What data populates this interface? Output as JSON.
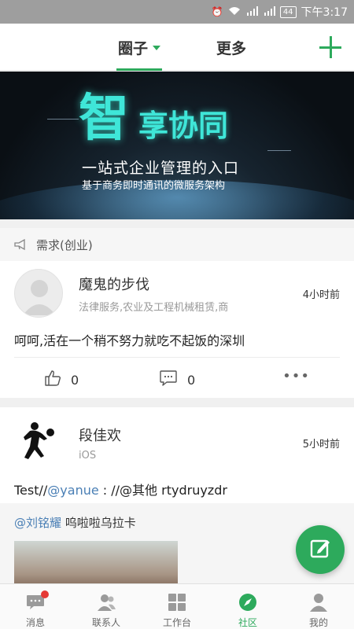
{
  "status_bar": {
    "time": "下午3:17",
    "battery": "44",
    "icons": [
      "alarm-icon",
      "wifi-icon",
      "signal-2g-icon",
      "signal-4g-icon",
      "battery-icon"
    ]
  },
  "top_nav": {
    "tabs": [
      {
        "label": "圈子",
        "active": true
      },
      {
        "label": "更多",
        "active": false
      }
    ],
    "add_icon": "plus-icon"
  },
  "banner": {
    "title_big": "智",
    "title_rest": "享协同",
    "subtitle": "一站式企业管理的入口",
    "tagline": "基于商务即时通讯的微服务架构"
  },
  "category": {
    "label": "需求(创业)",
    "icon": "megaphone-icon"
  },
  "posts": [
    {
      "author": "魔鬼的步伐",
      "meta": "法律服务,农业及工程机械租赁,商",
      "time": "4小时前",
      "content": "呵呵,活在一个稍不努力就吃不起饭的深圳",
      "likes": "0",
      "comments": "0"
    },
    {
      "author": "段佳欢",
      "meta": "iOS",
      "time": "5小时前",
      "content_prefix": "Test//",
      "content_mention": "@yanue",
      "content_suffix": " : //@其他 rtydruyzdr",
      "quote_mention": "@刘铭耀",
      "quote_text": " 呜啦啦乌拉卡"
    }
  ],
  "bottom_tabs": [
    {
      "label": "消息",
      "icon": "chat-icon",
      "active": false,
      "badge": true
    },
    {
      "label": "联系人",
      "icon": "contacts-icon",
      "active": false,
      "badge": false
    },
    {
      "label": "工作台",
      "icon": "grid-icon",
      "active": false,
      "badge": false
    },
    {
      "label": "社区",
      "icon": "compass-icon",
      "active": true,
      "badge": false
    },
    {
      "label": "我的",
      "icon": "person-icon",
      "active": false,
      "badge": false
    }
  ],
  "colors": {
    "accent": "#2daa5c",
    "mention": "#4a7fb5",
    "badge": "#e53935"
  }
}
